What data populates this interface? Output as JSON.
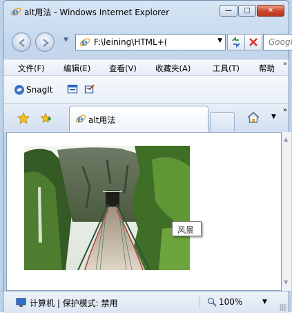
{
  "window": {
    "title": "alt用法 - Windows Internet Explorer",
    "caption_buttons": {
      "minimize": "—",
      "maximize": "□",
      "close": "✕"
    }
  },
  "navigation": {
    "address": "F:\\leining\\HTML+(",
    "search_placeholder": "Google"
  },
  "menu": {
    "items": [
      "文件(F)",
      "编辑(E)",
      "查看(V)",
      "收藏夹(A)",
      "工具(T)",
      "帮助"
    ],
    "overflow": "»"
  },
  "links_bar": {
    "snagit_label": "SnagIt"
  },
  "tabs": {
    "active_tab": "alt用法",
    "overflow": "»"
  },
  "content": {
    "image_alt_tooltip": "风景"
  },
  "status": {
    "text": "计算机 | 保护模式: 禁用",
    "zoom": "100%"
  },
  "colors": {
    "frame": "#c4d7ec",
    "close_button": "#c8452c",
    "ie_icon": "#2d7be0"
  },
  "icons": {
    "back": "back-arrow-icon",
    "forward": "forward-arrow-icon",
    "refresh": "refresh-icon",
    "stop": "stop-icon",
    "favorites": "star-icon",
    "add_favorite": "add-favorite-icon",
    "home": "home-icon",
    "zoom": "magnifier-icon",
    "computer": "computer-icon"
  }
}
